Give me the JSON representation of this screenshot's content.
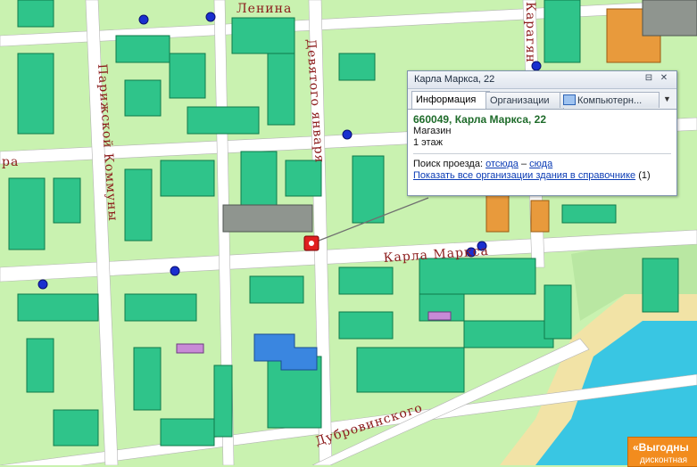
{
  "streets": {
    "lenina": "Ленина",
    "devyatogo_yanvarya": "Девятого января",
    "parizhskoy_kommuny": "Парижской Коммуны",
    "karla_marksa": "Карла Маркса",
    "karagan": "Карагян",
    "dubrovinskogo": "Дубровинского",
    "ra_fragment": "ра"
  },
  "popup": {
    "title": "Карла Маркса, 22",
    "tabs": [
      "Информация",
      "Организации",
      "Компьютерн..."
    ],
    "address": "660049, Карла Маркса, 22",
    "type": "Магазин",
    "floors": "1 этаж",
    "route_label": "Поиск проезда:",
    "route_from": "отсюда",
    "route_dash": "–",
    "route_to": "сюда",
    "show_orgs": "Показать все организации здания в справочнике",
    "org_count": "(1)"
  },
  "ad": {
    "line1": "«Выгодны",
    "line2": "дисконтная"
  },
  "colors": {
    "land": "#c9f2b0",
    "road": "#ffffff",
    "building": "#2fc48a",
    "water": "#39c6e3",
    "marker": "#e02020",
    "stop": "#1a2fcf"
  }
}
